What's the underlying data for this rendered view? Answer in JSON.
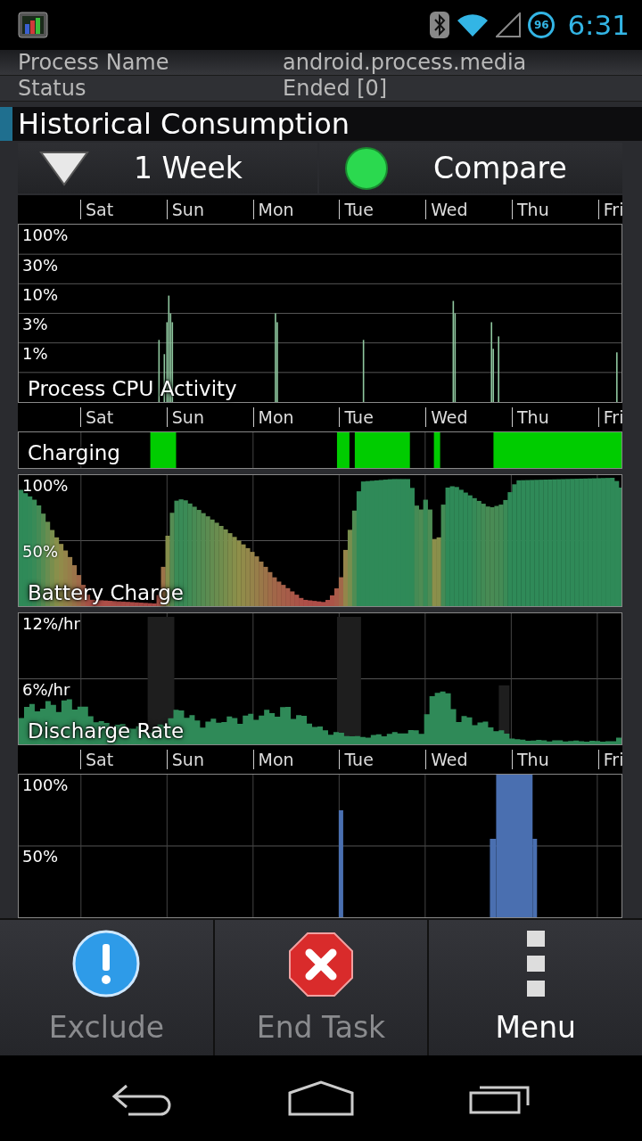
{
  "status_bar": {
    "battery": "96",
    "time": "6:31"
  },
  "info_rows": [
    {
      "label": "Process Name",
      "value": "android.process.media"
    },
    {
      "label": "Status",
      "value": "Ended [0]"
    }
  ],
  "section": {
    "title": "Historical Consumption"
  },
  "controls": [
    {
      "kind": "dropdown",
      "label": "1 Week"
    },
    {
      "kind": "toggle",
      "label": "Compare",
      "on": true
    }
  ],
  "panels": [
    {
      "kind": "axis",
      "days": [
        "Sat",
        "Sun",
        "Mon",
        "Tue",
        "Wed",
        "Thu",
        "Fri"
      ]
    },
    {
      "kind": "cpu",
      "title": "Process CPU Activity",
      "ticks": [
        "100%",
        "30%",
        "10%",
        "3%",
        "1%"
      ]
    },
    {
      "kind": "axis",
      "days": [
        "Sat",
        "Sun",
        "Mon",
        "Tue",
        "Wed",
        "Thu",
        "Fri"
      ]
    },
    {
      "kind": "charging",
      "title": "Charging"
    },
    {
      "kind": "battery",
      "title": "Battery Charge",
      "ticks": [
        "100%",
        "50%"
      ]
    },
    {
      "kind": "discharge",
      "title": "Discharge Rate",
      "ticks": [
        "12%/hr",
        "6%/hr"
      ]
    },
    {
      "kind": "axis",
      "days": [
        "Sat",
        "Sun",
        "Mon",
        "Tue",
        "Wed",
        "Thu",
        "Fri"
      ]
    },
    {
      "kind": "usage",
      "ticks": [
        "100%",
        "50%"
      ]
    }
  ],
  "toolbar": [
    {
      "kind": "info",
      "label": "Exclude",
      "disabled": true
    },
    {
      "kind": "stop",
      "label": "End Task",
      "disabled": true
    },
    {
      "kind": "menu",
      "label": "Menu",
      "disabled": false
    }
  ]
}
